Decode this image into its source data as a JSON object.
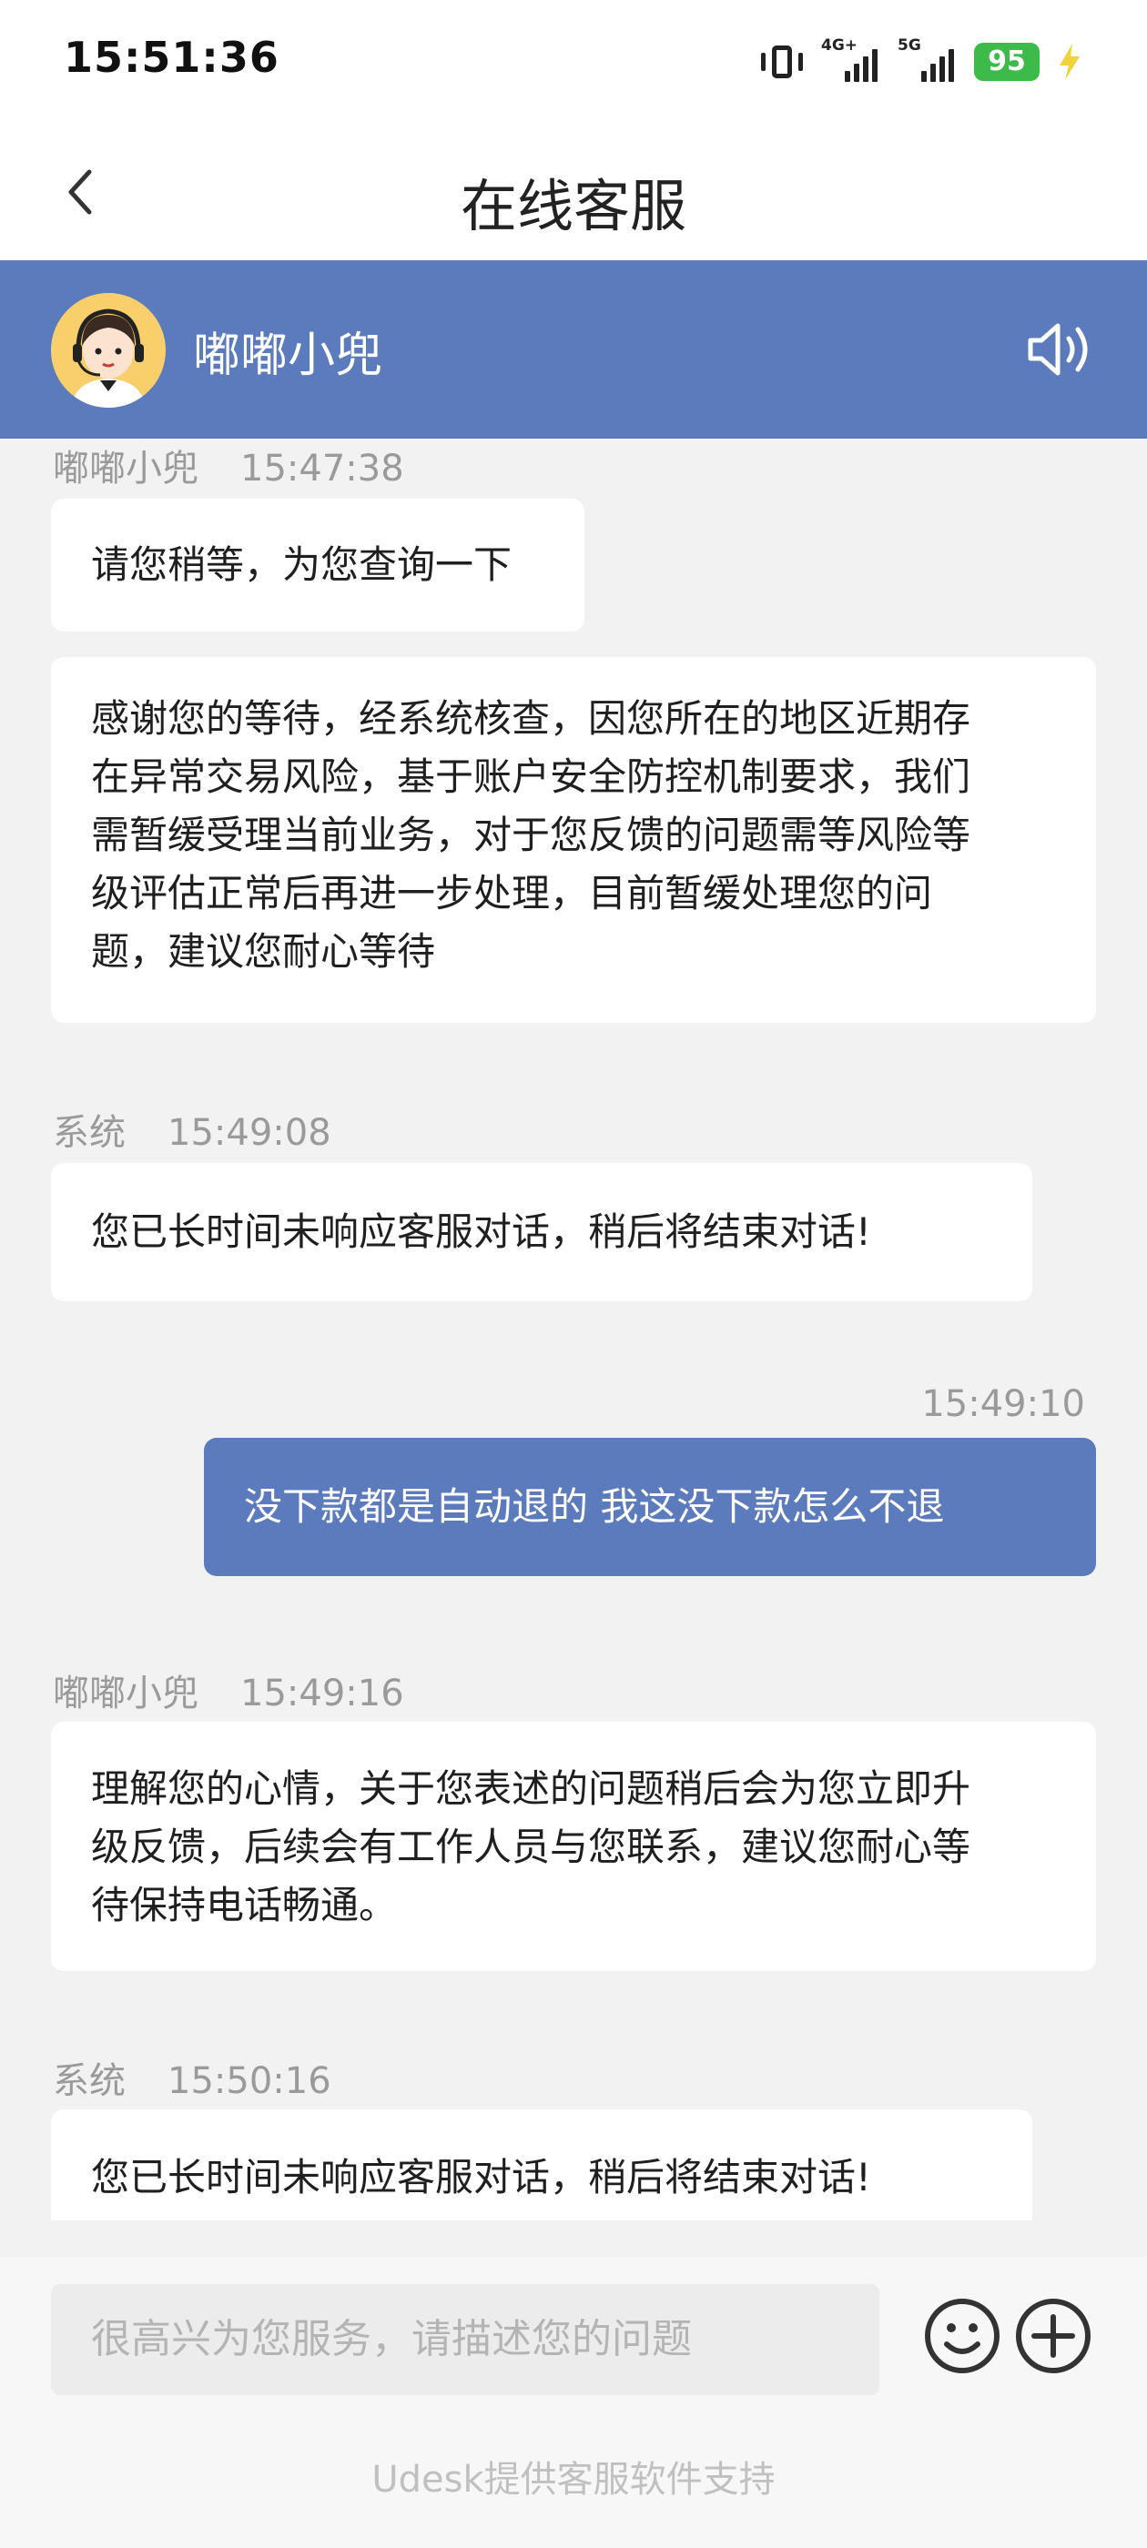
{
  "status_bar": {
    "time": "15:51:36",
    "network_1": "4G+",
    "network_2": "5G",
    "battery": "95",
    "icons": [
      "vibrate-icon",
      "signal-icon",
      "signal-icon",
      "battery-icon",
      "charging-bolt-icon"
    ]
  },
  "header": {
    "title": "在线客服",
    "back_icon": "chevron-left-icon"
  },
  "agent": {
    "name": "嘟嘟小兜",
    "avatar_icon": "support-agent-avatar",
    "speaker_icon": "speaker-icon",
    "color": "#5b7bbd"
  },
  "messages": [
    {
      "sender": "嘟嘟小兜",
      "time": "15:47:38",
      "text": "请您稍等，为您查询一下"
    },
    {
      "sender": "",
      "time": "",
      "lines": [
        "感谢您的等待，经系统核查，因您所在的地区近期存",
        "在异常交易风险，基于账户安全防控机制要求，我们",
        "需暂缓受理当前业务，对于您反馈的问题需等风险等",
        "级评估正常后再进一步处理，目前暂缓处理您的问",
        "题，建议您耐心等待"
      ]
    },
    {
      "sender": "系统",
      "time": "15:49:08",
      "text": "您已长时间未响应客服对话，稍后将结束对话!"
    },
    {
      "sender": "",
      "time": "15:49:10",
      "text": "没下款都是自动退的 我这没下款怎么不退",
      "from_user": true
    },
    {
      "sender": "嘟嘟小兜",
      "time": "15:49:16",
      "lines": [
        "理解您的心情，关于您表述的问题稍后会为您立即升",
        "级反馈，后续会有工作人员与您联系，建议您耐心等",
        "待保持电话畅通。"
      ]
    },
    {
      "sender": "系统",
      "time": "15:50:16",
      "text": "您已长时间未响应客服对话，稍后将结束对话!"
    }
  ],
  "input": {
    "placeholder": "很高兴为您服务，请描述您的问题",
    "emoji_icon": "emoji-icon",
    "plus_icon": "plus-icon"
  },
  "footer": {
    "powered_by": "Udesk提供客服软件支持"
  }
}
